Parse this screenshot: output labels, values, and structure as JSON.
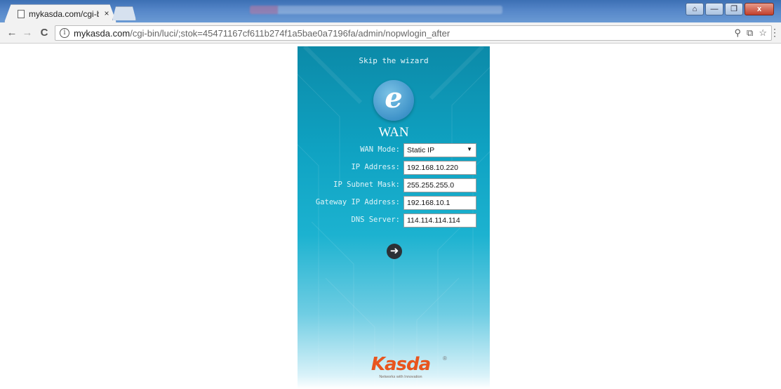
{
  "browser": {
    "tab_title": "mykasda.com/cgi-bin/",
    "tab_close": "×",
    "url_host": "mykasda.com",
    "url_path": "/cgi-bin/luci/;stok=45471167cf611b274f1a5bae0a7196fa/admin/nopwlogin_after",
    "nav_back": "←",
    "nav_forward": "→",
    "nav_reload": "C",
    "info_glyph": "i",
    "omni_icons": [
      "⚲",
      "⧉",
      "☆"
    ],
    "menu": "⋮",
    "window_controls": {
      "help": "⌂",
      "minimize": "—",
      "maximize": "❐",
      "close": "x"
    }
  },
  "page": {
    "skip_link": "Skip the wizard",
    "logo_letter": "e",
    "section_title": "WAN",
    "fields": [
      {
        "label": "WAN Mode:",
        "value": "Static IP",
        "type": "select"
      },
      {
        "label": "IP Address:",
        "value": "192.168.10.220",
        "type": "text"
      },
      {
        "label": "IP Subnet Mask:",
        "value": "255.255.255.0",
        "type": "text"
      },
      {
        "label": "Gateway IP Address:",
        "value": "192.168.10.1",
        "type": "text"
      },
      {
        "label": "DNS Server:",
        "value": "114.114.114.114",
        "type": "text"
      }
    ],
    "select_arrow": "▼",
    "next_glyph": "➜",
    "brand": "Kasda",
    "brand_reg": "®",
    "tagline": "Networks with Innovation"
  },
  "colors": {
    "panel_top": "#0c8aa8",
    "panel_mid": "#1cb2d0",
    "brand": "#e8551e",
    "title_bar": "#3c6fb4"
  }
}
